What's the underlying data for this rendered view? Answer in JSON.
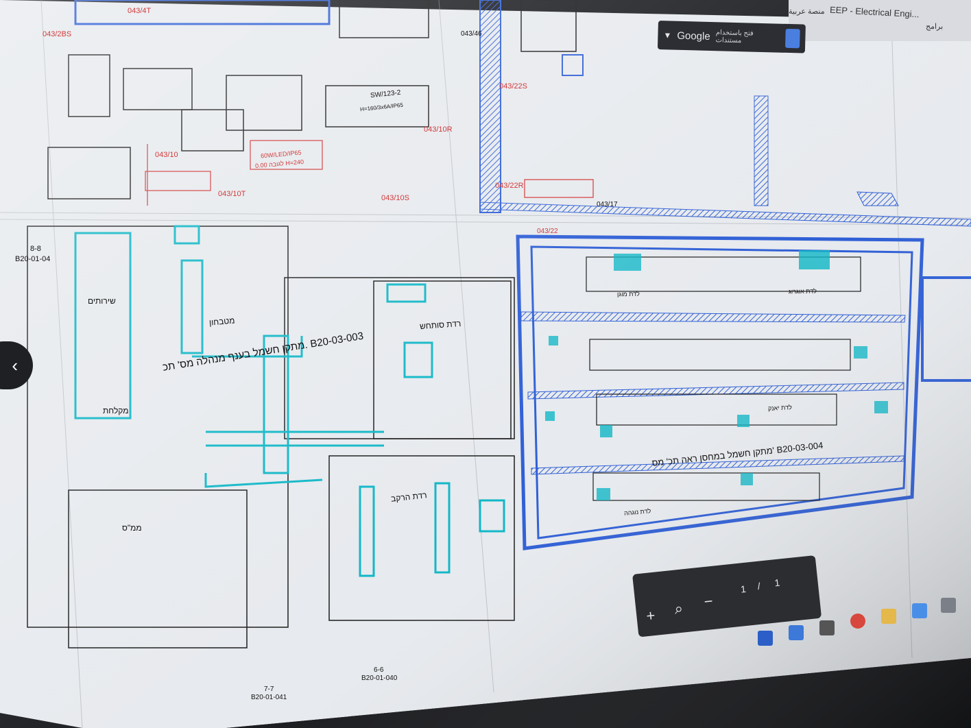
{
  "browser": {
    "tab_text_1": "EEP - Electrical Engi...",
    "tab_text_2": "منصة عربية",
    "apps_label": "برامج"
  },
  "google_bar": {
    "label": "Google",
    "sub_label": "فتح باستخدام مستندات"
  },
  "drawing": {
    "title_admin": "מתקן חשמל בענף מנהלה מס' תכ. B20-03-003",
    "title_storage": "מתקן חשמל במחסן ראה תכ' מס' B20-03-004",
    "section_ref_1": "8-8",
    "section_ref_1_sheet": "B20-01-04",
    "section_ref_2": "7-7",
    "section_ref_2_sheet": "B20-01-041",
    "section_ref_3": "6-6",
    "section_ref_3_sheet": "B20-01-040",
    "room_kitchenette": "מטבחון",
    "room_toilet": "שירותים",
    "room_showers": "מקלחת",
    "room_ups": "רדת סותחש",
    "room_shelter": "ממ\"ס",
    "room_vehicle": "רדת הרקב",
    "red_tags": [
      "043/4T",
      "043/2BS",
      "043/10",
      "043/10T",
      "043/10S",
      "043/10R",
      "043/46",
      "043/22S",
      "043/22R",
      "043/17",
      "043/22"
    ],
    "panel_note": "SW/123-2",
    "panel_spec": "H=160/3x6A/IP65",
    "light_note": "60W/LED/IP65",
    "light_height": "0.00 לגובה H=240",
    "storage_rows": [
      "לדת מוגן",
      "לדת אוגרוג",
      "לדת יאנק",
      "לדת נוגהה"
    ]
  },
  "viewer": {
    "page_current": "1",
    "page_sep": "/",
    "page_total": "1",
    "zoom_in": "+",
    "zoom_out": "−",
    "search_icon": "magnifier-icon"
  },
  "colors": {
    "paper": "#e9ecef",
    "cyan": "#10b7c7",
    "blue": "#2f5fd6",
    "red": "#d23a3a",
    "ink": "#1a1a1a"
  }
}
